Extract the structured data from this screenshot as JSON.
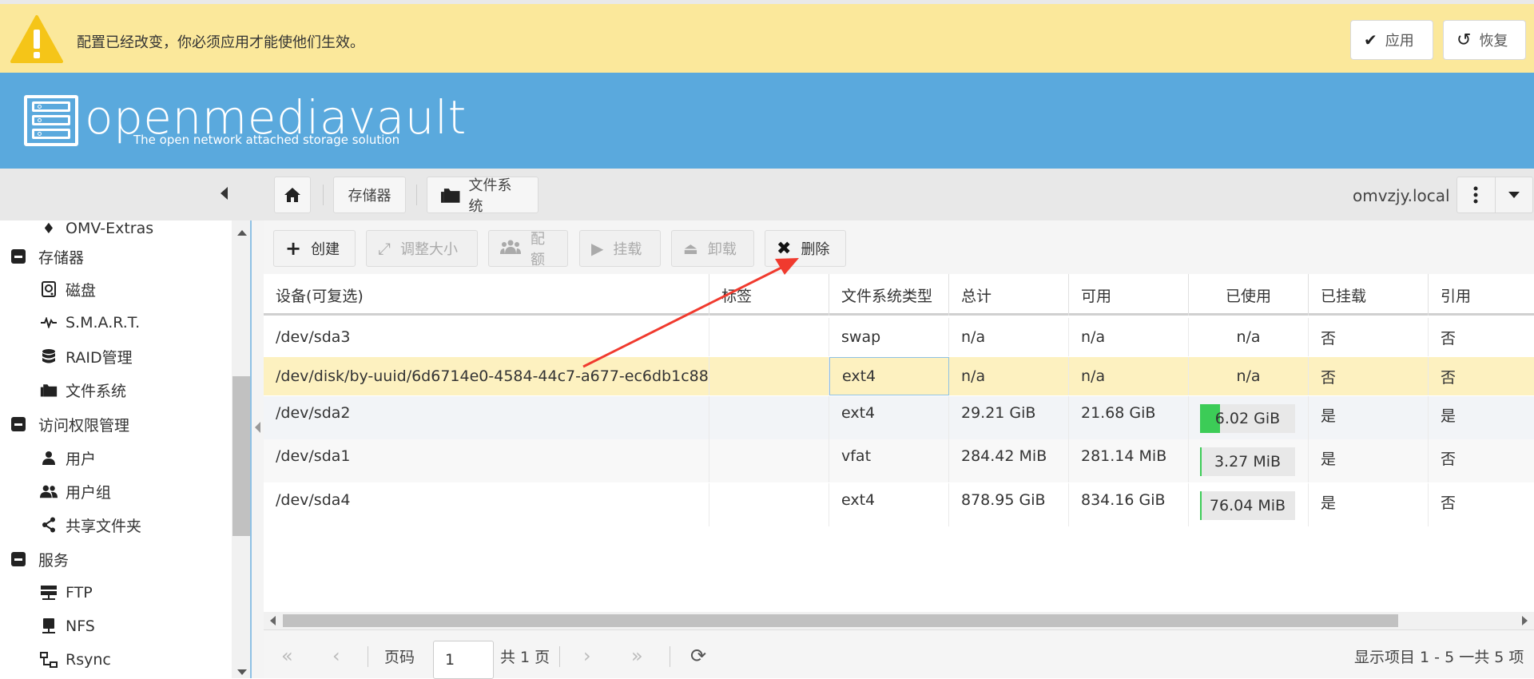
{
  "notification": {
    "message": "配置已经改变，你必须应用才能使他们生效。",
    "apply_label": "应用",
    "revert_label": "恢复"
  },
  "brand": {
    "name": "openmediavault",
    "tagline": "The open network attached storage solution"
  },
  "breadcrumb": {
    "items": [
      "存储器",
      "文件系统"
    ]
  },
  "host": "omvzjy.local",
  "sidebar": {
    "partial_top": "OMV-Extras",
    "groups": [
      {
        "label": "存储器",
        "items": [
          "磁盘",
          "S.M.A.R.T.",
          "RAID管理",
          "文件系统"
        ]
      },
      {
        "label": "访问权限管理",
        "items": [
          "用户",
          "用户组",
          "共享文件夹"
        ]
      },
      {
        "label": "服务",
        "items": [
          "FTP",
          "NFS",
          "Rsync"
        ]
      }
    ]
  },
  "toolbar": {
    "create": "创建",
    "resize": "调整大小",
    "quota": "配额",
    "mount": "挂载",
    "unmount": "卸载",
    "delete": "删除"
  },
  "table": {
    "columns": [
      "设备(可复选)",
      "标签",
      "文件系统类型",
      "总计",
      "可用",
      "已使用",
      "已挂载",
      "引用"
    ],
    "rows": [
      {
        "device": "/dev/sda3",
        "label": "",
        "fstype": "swap",
        "total": "n/a",
        "available": "n/a",
        "used": "n/a",
        "used_pct": null,
        "mounted": "否",
        "referenced": "否"
      },
      {
        "device": "/dev/disk/by-uuid/6d6714e0-4584-44c7-a677-ec6db1c88...",
        "label": "",
        "fstype": "ext4",
        "total": "n/a",
        "available": "n/a",
        "used": "n/a",
        "used_pct": null,
        "mounted": "否",
        "referenced": "否"
      },
      {
        "device": "/dev/sda2",
        "label": "",
        "fstype": "ext4",
        "total": "29.21 GiB",
        "available": "21.68 GiB",
        "used": "6.02 GiB",
        "used_pct": 0.21,
        "mounted": "是",
        "referenced": "是"
      },
      {
        "device": "/dev/sda1",
        "label": "",
        "fstype": "vfat",
        "total": "284.42 MiB",
        "available": "281.14 MiB",
        "used": "3.27 MiB",
        "used_pct": 0.012,
        "mounted": "是",
        "referenced": "否"
      },
      {
        "device": "/dev/sda4",
        "label": "",
        "fstype": "ext4",
        "total": "878.95 GiB",
        "available": "834.16 GiB",
        "used": "76.04 MiB",
        "used_pct": 0.01,
        "mounted": "是",
        "referenced": "否"
      }
    ]
  },
  "pager": {
    "page_label": "页码",
    "page_value": "1",
    "total_pages": "共 1 页",
    "summary": "显示项目 1 - 5 一共 5 项"
  },
  "colors": {
    "notify_bg": "#fbe89b",
    "brand_bg": "#5aa9dd",
    "selected_row": "#fdf1c0",
    "usage_fill": "#3ccc57",
    "annotation": "#f03a2e"
  }
}
